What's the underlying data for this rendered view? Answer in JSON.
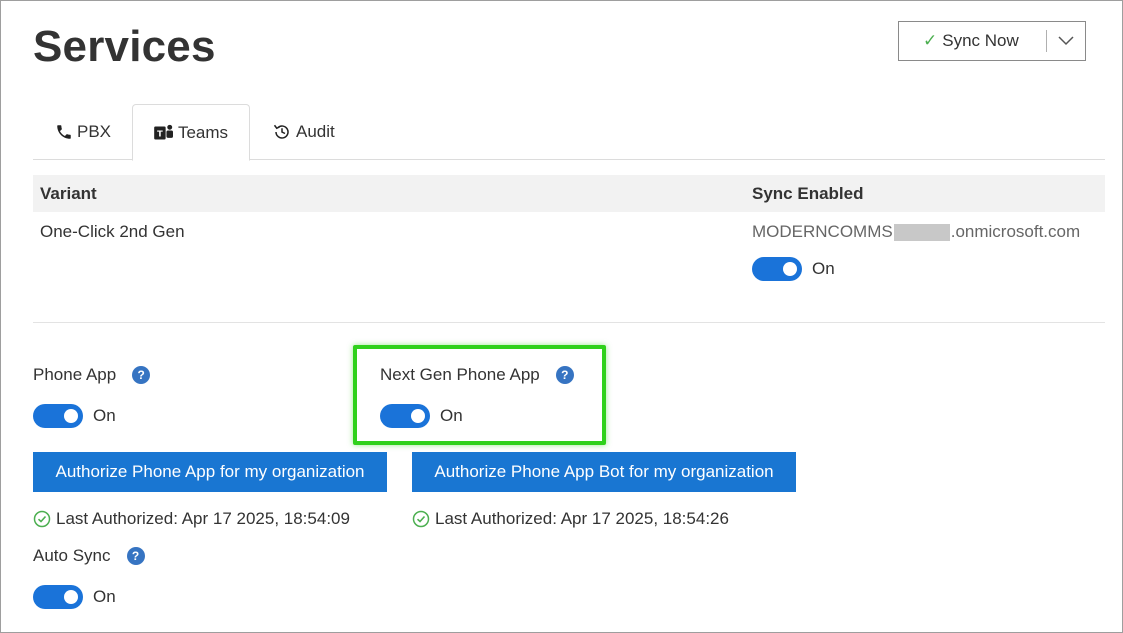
{
  "page": {
    "title": "Services"
  },
  "sync": {
    "label": "Sync Now",
    "check_icon": "check-icon",
    "dropdown_icon": "chevron-down-icon"
  },
  "tabs": [
    {
      "label": "PBX",
      "icon": "phone-icon"
    },
    {
      "label": "Teams",
      "icon": "teams-icon",
      "active": true
    },
    {
      "label": "Audit",
      "icon": "history-icon"
    }
  ],
  "table": {
    "headers": {
      "variant": "Variant",
      "sync_enabled": "Sync Enabled"
    },
    "row": {
      "variant": "One-Click 2nd Gen",
      "tenant_prefix": "MODERNCOMMS",
      "tenant_suffix": ".onmicrosoft.com",
      "toggle_label": "On",
      "toggle_on": true
    }
  },
  "phone_app": {
    "label": "Phone App",
    "toggle_label": "On",
    "toggle_on": true,
    "help": "?"
  },
  "next_gen": {
    "label": "Next Gen Phone App",
    "toggle_label": "On",
    "toggle_on": true,
    "help": "?"
  },
  "buttons": {
    "authorize": "Authorize Phone App for my organization",
    "authorize_bot": "Authorize Phone App Bot for my organization"
  },
  "last_authorized": {
    "phone_app": "Last Authorized: Apr 17 2025, 18:54:09",
    "bot": "Last Authorized: Apr 17 2025, 18:54:26"
  },
  "auto_sync": {
    "label": "Auto Sync",
    "toggle_label": "On",
    "toggle_on": true,
    "help": "?"
  },
  "colors": {
    "accent": "#1976d2",
    "toggle": "#1a73d9",
    "help": "#3674c2",
    "highlight": "#2fd11b",
    "success": "#4caf50"
  }
}
